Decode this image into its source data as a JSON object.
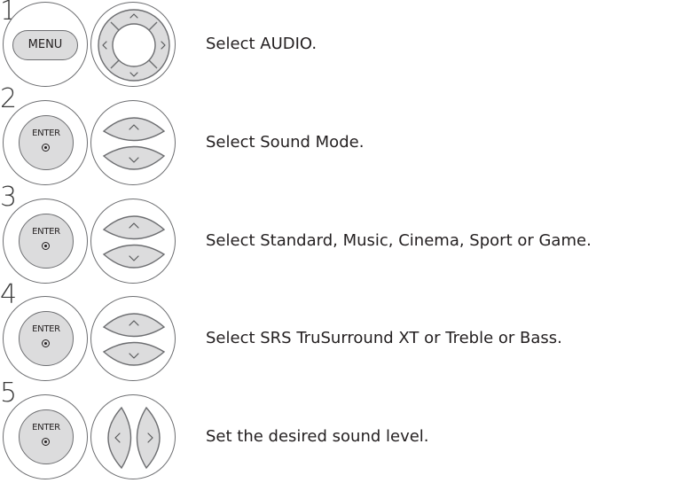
{
  "steps": [
    {
      "number": "1",
      "button_label": "MENU",
      "nav_icon": "four-way-arrow-pad",
      "instruction": "Select AUDIO."
    },
    {
      "number": "2",
      "button_label": "ENTER",
      "nav_icon": "up-down-arrow-buttons",
      "instruction": "Select Sound Mode."
    },
    {
      "number": "3",
      "button_label": "ENTER",
      "nav_icon": "up-down-arrow-buttons",
      "instruction": "Select Standard, Music, Cinema, Sport or Game."
    },
    {
      "number": "4",
      "button_label": "ENTER",
      "nav_icon": "up-down-arrow-buttons",
      "instruction": "Select SRS TruSurround XT or Treble or Bass."
    },
    {
      "number": "5",
      "button_label": "ENTER",
      "nav_icon": "left-right-arrow-buttons",
      "instruction": "Set the desired sound level."
    }
  ],
  "colors": {
    "button_fill": "#dcdcdd",
    "outline": "#6d6e71",
    "text": "#231f20"
  }
}
